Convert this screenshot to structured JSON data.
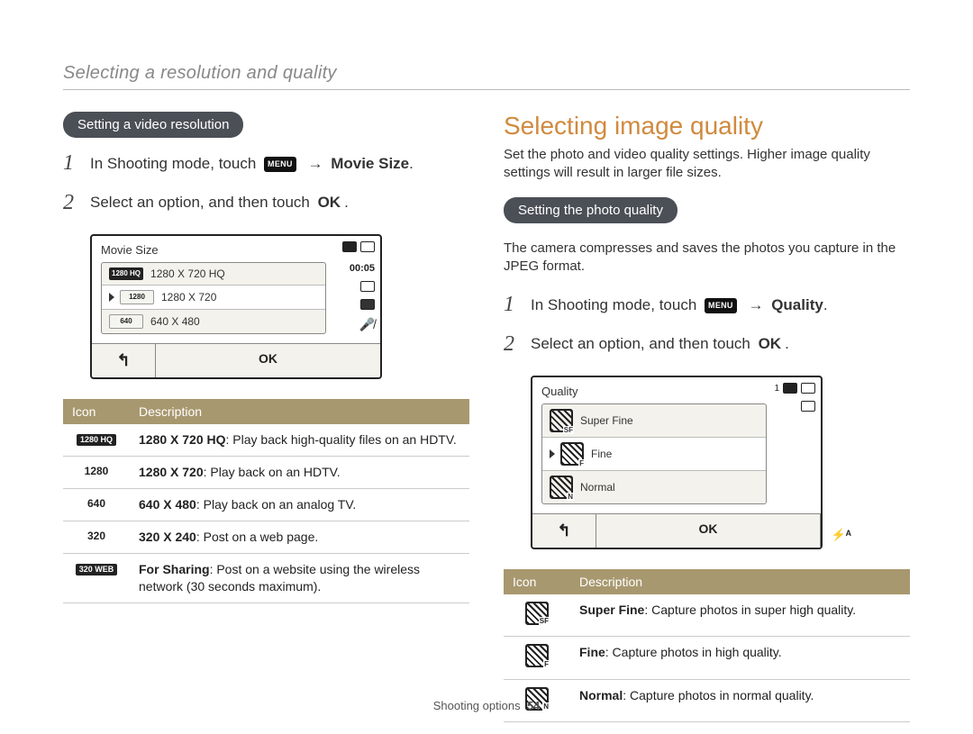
{
  "breadcrumb": "Selecting a resolution and quality",
  "left": {
    "pill": "Setting a video resolution",
    "step1_a": "In Shooting mode, touch ",
    "step1_menu": "MENU",
    "step1_arrow": "→",
    "step1_b": "Movie Size",
    "step2_a": "Select an option, and then touch ",
    "step2_ok": "OK",
    "screen": {
      "title": "Movie Size",
      "timer": "00:05",
      "controls_back": "↰",
      "controls_ok": "OK",
      "options": [
        {
          "tag": "1280 HQ",
          "label": "1280 X 720 HQ",
          "style": "dark"
        },
        {
          "tag": "1280",
          "label": "1280 X 720",
          "style": "light",
          "selected": true
        },
        {
          "tag": "640",
          "label": "640 X 480",
          "style": "light"
        }
      ]
    },
    "table": {
      "h1": "Icon",
      "h2": "Description",
      "rows": [
        {
          "icon": "1280 HQ",
          "tag": true,
          "title": "1280 X 720 HQ",
          "desc": ": Play back high-quality files on an HDTV."
        },
        {
          "icon": "1280",
          "tag": false,
          "title": "1280 X 720",
          "desc": ": Play back on an HDTV."
        },
        {
          "icon": "640",
          "tag": false,
          "title": "640 X 480",
          "desc": ": Play back on an analog TV."
        },
        {
          "icon": "320",
          "tag": false,
          "title": "320 X 240",
          "desc": ": Post on a web page."
        },
        {
          "icon": "320 WEB",
          "tag": true,
          "title": "For Sharing",
          "desc": ": Post on a website using the wireless network (30 seconds maximum)."
        }
      ]
    }
  },
  "right": {
    "title": "Selecting image quality",
    "intro": "Set the photo and video quality settings. Higher image quality settings will result in larger file sizes.",
    "pill": "Setting the photo quality",
    "sub_intro": "The camera compresses and saves the photos you capture in the JPEG format.",
    "step1_a": "In Shooting mode, touch ",
    "step1_menu": "MENU",
    "step1_arrow": "→",
    "step1_b": "Quality",
    "step2_a": "Select an option, and then touch ",
    "step2_ok": "OK",
    "screen": {
      "title": "Quality",
      "count": "1",
      "controls_back": "↰",
      "controls_ok": "OK",
      "flash": "⚡ᴬ",
      "options": [
        {
          "sub": "SF",
          "label": "Super Fine"
        },
        {
          "sub": "F",
          "label": "Fine",
          "selected": true
        },
        {
          "sub": "N",
          "label": "Normal"
        }
      ]
    },
    "table": {
      "h1": "Icon",
      "h2": "Description",
      "rows": [
        {
          "sub": "SF",
          "title": "Super Fine",
          "desc": ": Capture photos in super high quality."
        },
        {
          "sub": "F",
          "title": "Fine",
          "desc": ": Capture photos in high quality."
        },
        {
          "sub": "N",
          "title": "Normal",
          "desc": ": Capture photos in normal quality."
        }
      ]
    }
  },
  "footer": {
    "section": "Shooting options",
    "page": "54"
  }
}
